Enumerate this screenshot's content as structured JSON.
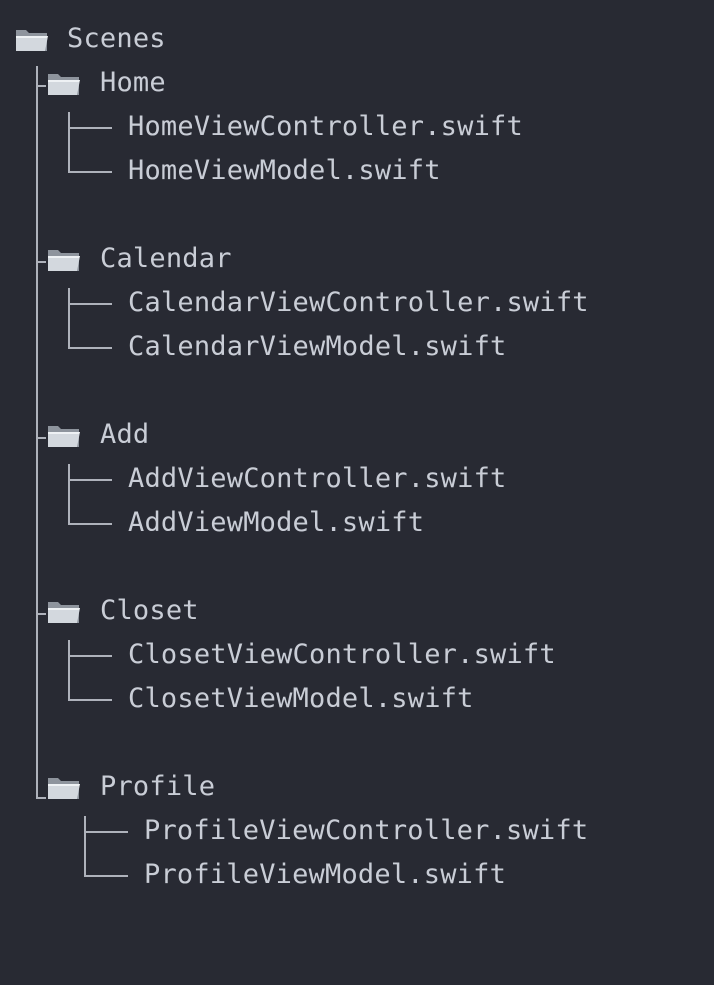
{
  "root": {
    "label": "Scenes",
    "icon": "folder-icon"
  },
  "folders": [
    {
      "label": "Home",
      "icon": "folder-icon",
      "files": [
        "HomeViewController.swift",
        "HomeViewModel.swift"
      ]
    },
    {
      "label": "Calendar",
      "icon": "folder-icon",
      "files": [
        "CalendarViewController.swift",
        "CalendarViewModel.swift"
      ]
    },
    {
      "label": "Add",
      "icon": "folder-icon",
      "files": [
        "AddViewController.swift",
        "AddViewModel.swift"
      ]
    },
    {
      "label": "Closet",
      "icon": "folder-icon",
      "files": [
        "ClosetViewController.swift",
        "ClosetViewModel.swift"
      ]
    },
    {
      "label": "Profile",
      "icon": "folder-icon",
      "files": [
        "ProfileViewController.swift",
        "ProfileViewModel.swift"
      ]
    }
  ],
  "colors": {
    "background": "#282a33",
    "text": "#c9cdd6",
    "lines": "#aeb2bb"
  }
}
